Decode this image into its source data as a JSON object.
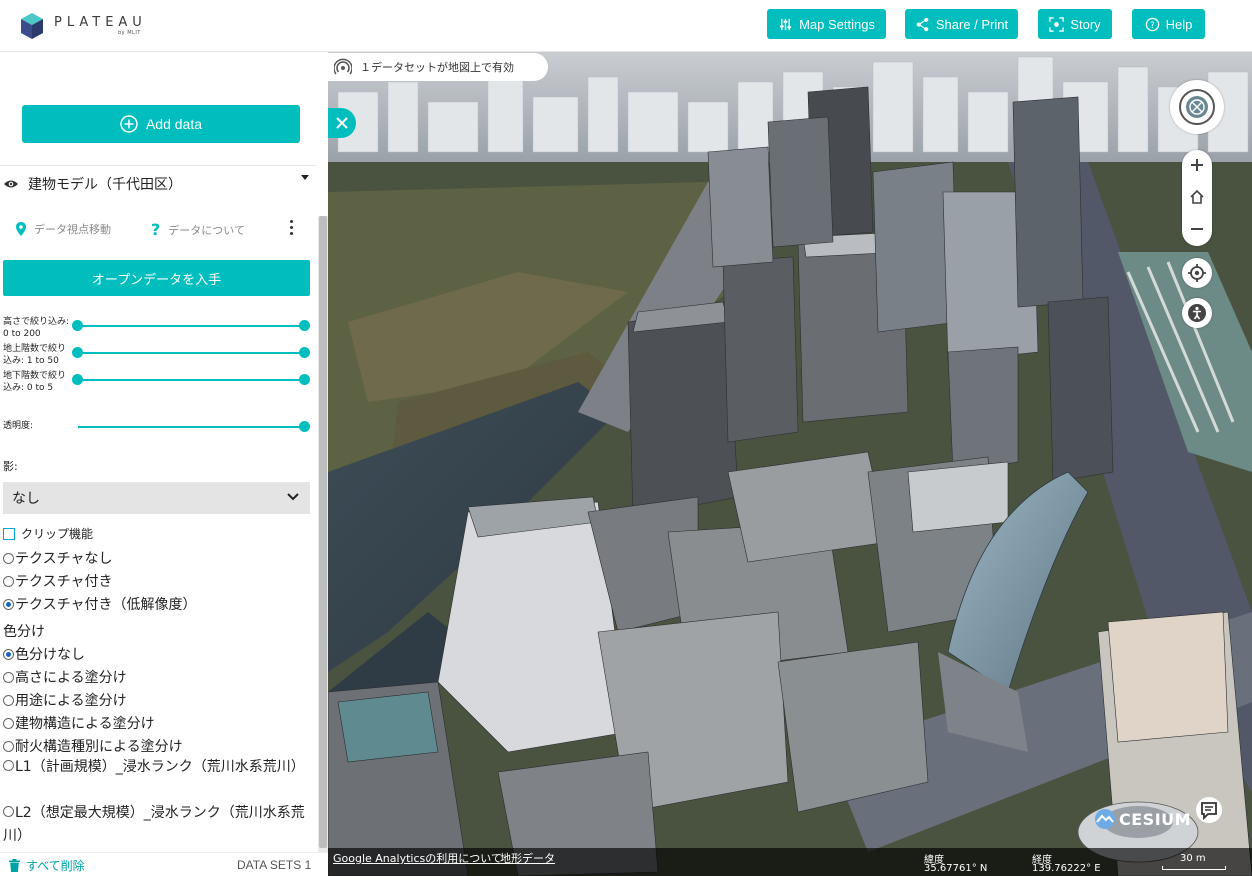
{
  "header": {
    "logo_text": "PLATEAU",
    "logo_sub": "by MLIT",
    "buttons": {
      "map_settings": "Map Settings",
      "share_print": "Share / Print",
      "story": "Story",
      "help": "Help"
    },
    "accent_color": "#00bebe"
  },
  "sidebar": {
    "add_data_label": "Add data",
    "layer": {
      "title": "建物モデル（千代田区）",
      "action_move": "データ視点移動",
      "action_about": "データについて",
      "open_data_label": "オープンデータを入手"
    },
    "filters": [
      {
        "label_line1": "高さで絞り込み:",
        "label_line2": "0 to 200",
        "min": 0,
        "max": 200
      },
      {
        "label_line1": "地上階数で絞り",
        "label_line2": "込み: 1 to 50",
        "min": 1,
        "max": 50
      },
      {
        "label_line1": "地下階数で絞り",
        "label_line2": "込み: 0 to 5",
        "min": 0,
        "max": 5
      }
    ],
    "opacity_label": "透明度:",
    "opacity_value": 1.0,
    "shadow_label": "影:",
    "shadow_selected": "なし",
    "clip_label": "クリップ機能",
    "texture_options": [
      {
        "label": "テクスチャなし",
        "selected": false
      },
      {
        "label": "テクスチャ付き",
        "selected": false
      },
      {
        "label": "テクスチャ付き（低解像度）",
        "selected": true
      }
    ],
    "color_heading": "色分け",
    "color_options": [
      {
        "label": "色分けなし",
        "selected": true
      },
      {
        "label": "高さによる塗分け",
        "selected": false
      },
      {
        "label": "用途による塗分け",
        "selected": false
      },
      {
        "label": "建物構造による塗分け",
        "selected": false
      },
      {
        "label": "耐火構造種別による塗分け",
        "selected": false
      },
      {
        "label": "L1（計画規模）_浸水ランク（荒川水系荒川）",
        "selected": false
      },
      {
        "label": "L2（想定最大規模）_浸水ランク（荒川水系荒川）",
        "selected": false
      }
    ],
    "footer": {
      "delete_all": "すべて削除",
      "datasets": "DATA SETS 1"
    }
  },
  "map": {
    "status_text": "１データセットが地図上で有効",
    "attribution": {
      "analytics_link": "Google Analyticsの利用について",
      "map_data_link": "地形データ"
    },
    "latitude_label": "緯度",
    "latitude_value": "35.67761° N",
    "longitude_label": "経度",
    "longitude_value": "139.76222° E",
    "scale_label": "30 m",
    "cesium_label": "CESIUM"
  }
}
